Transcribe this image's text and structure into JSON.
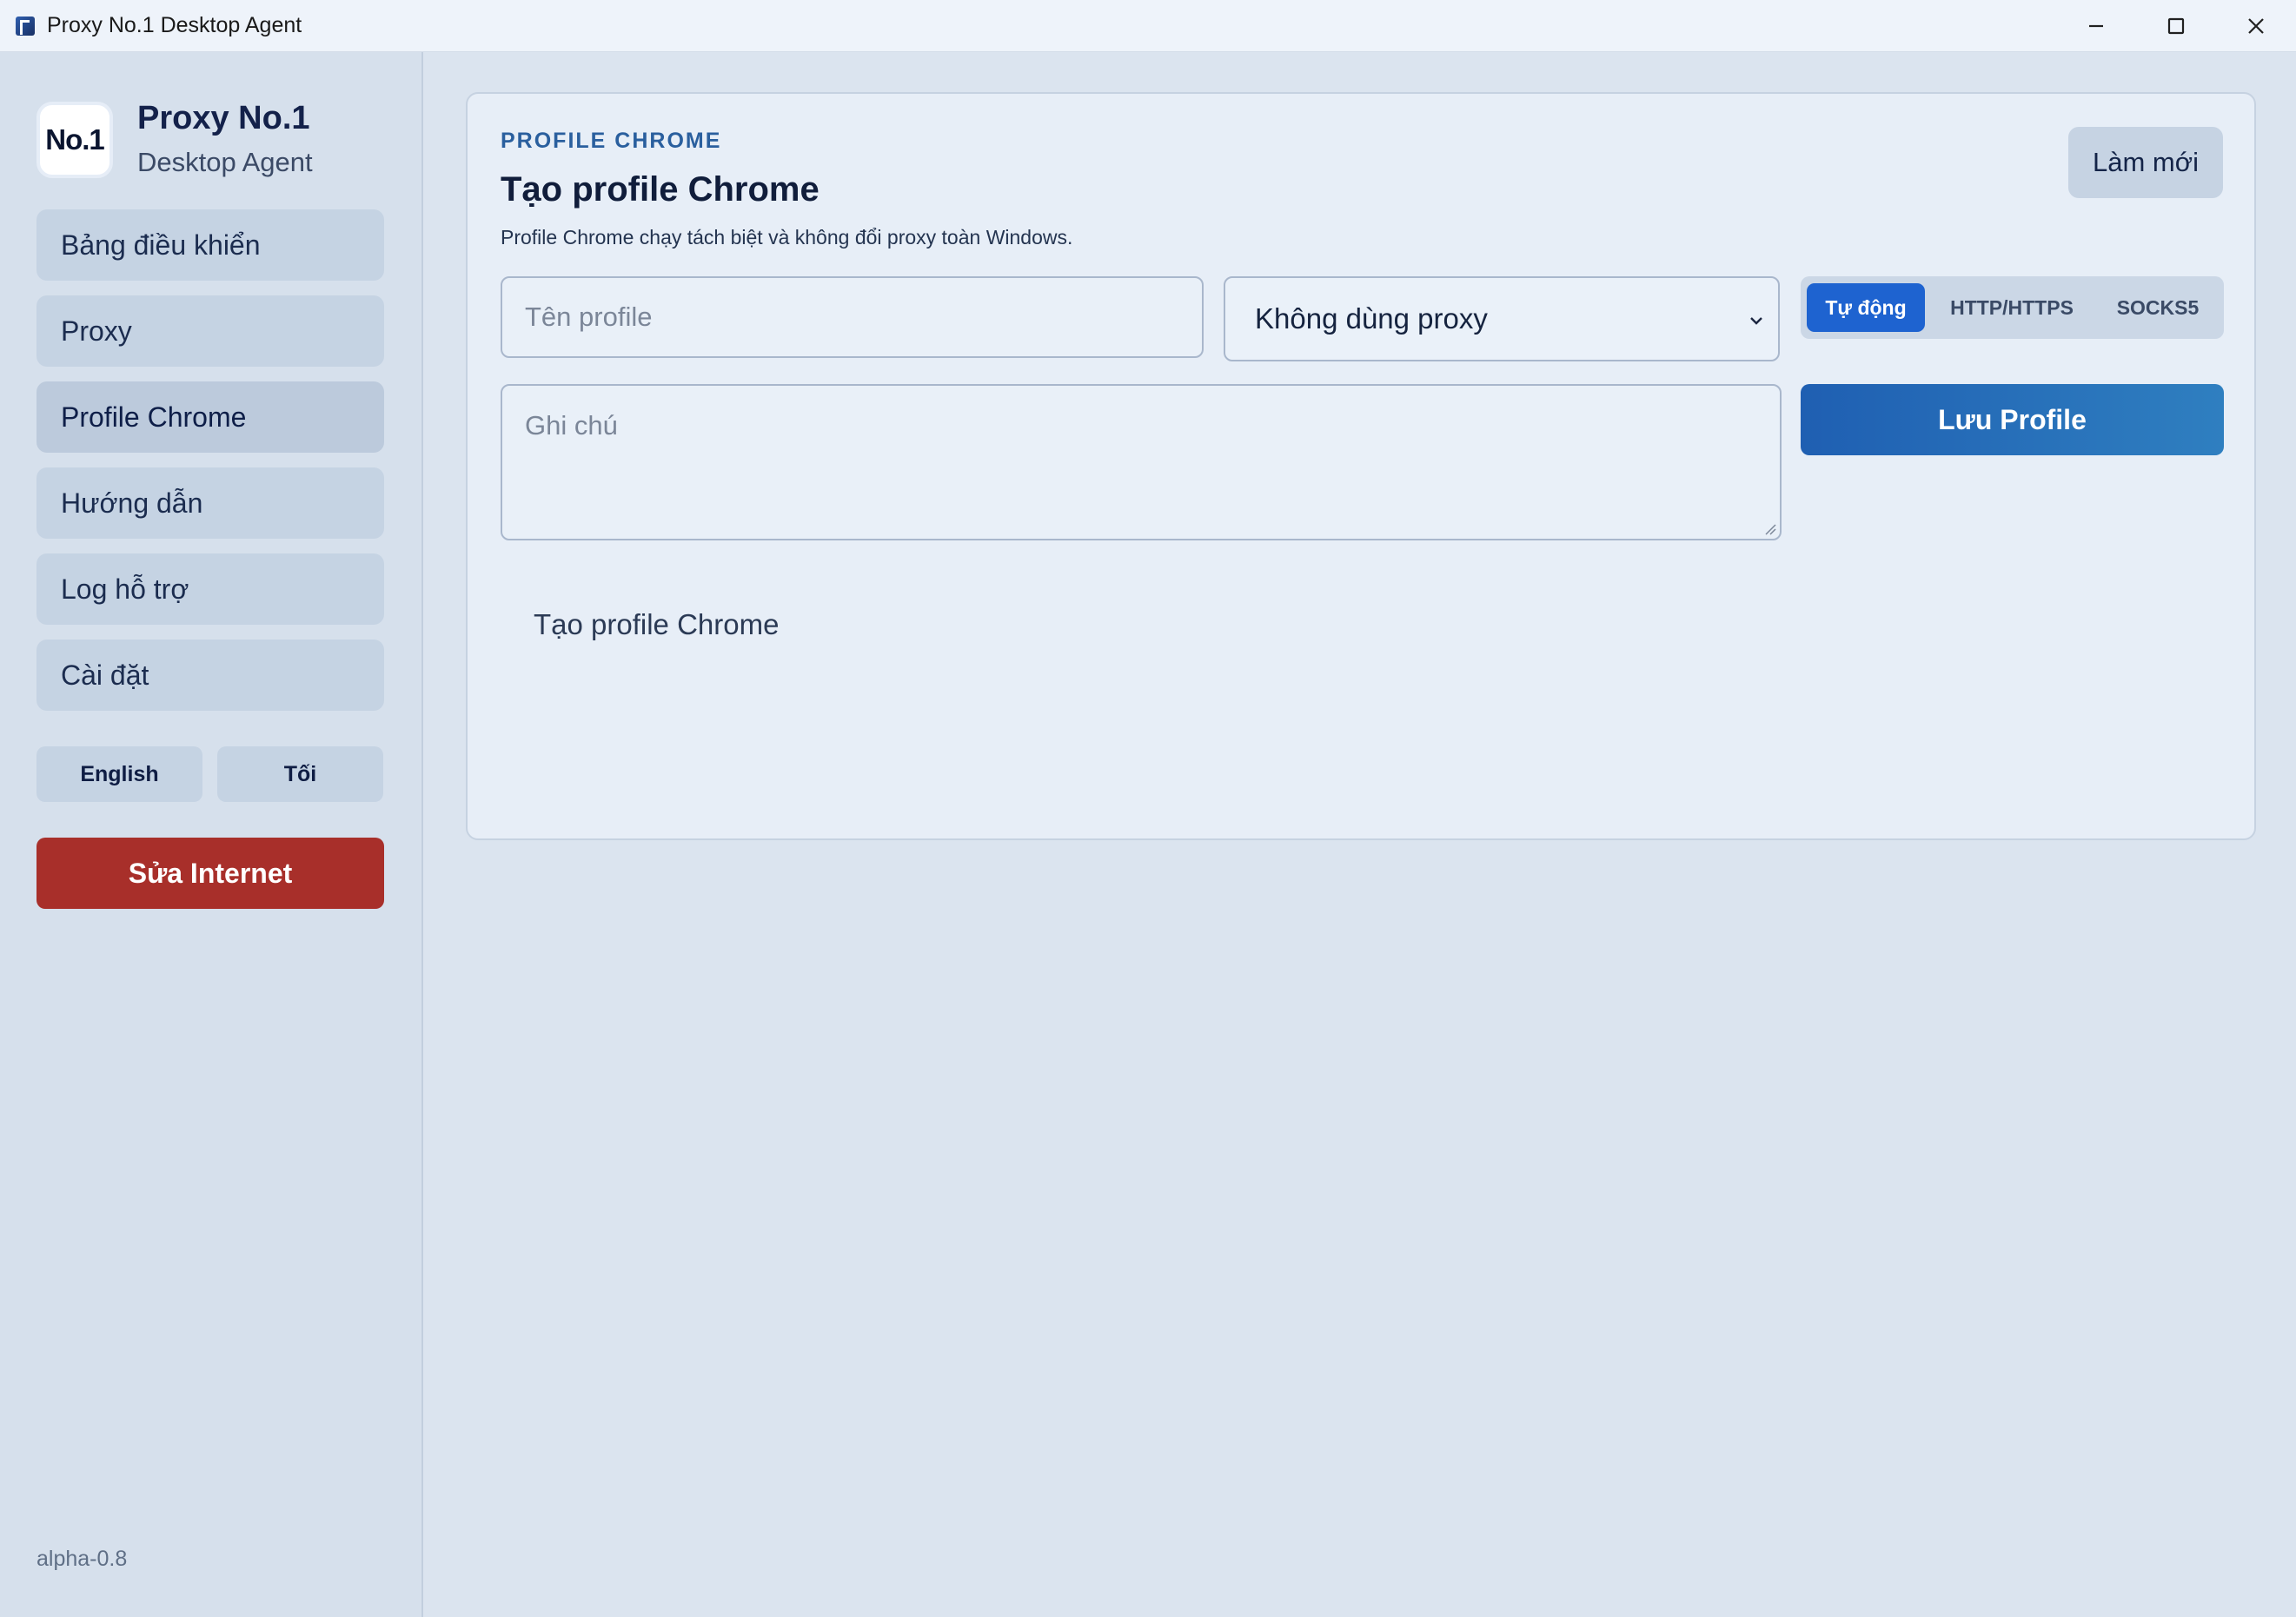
{
  "window": {
    "title": "Proxy No.1 Desktop Agent"
  },
  "brand": {
    "logo_text": "No.1",
    "title": "Proxy No.1",
    "subtitle": "Desktop Agent"
  },
  "sidebar": {
    "items": [
      {
        "label": "Bảng điều khiển",
        "active": false
      },
      {
        "label": "Proxy",
        "active": false
      },
      {
        "label": "Profile Chrome",
        "active": true
      },
      {
        "label": "Hướng dẫn",
        "active": false
      },
      {
        "label": "Log hỗ trợ",
        "active": false
      },
      {
        "label": "Cài đặt",
        "active": false
      }
    ],
    "language_button": "English",
    "theme_button": "Tối",
    "fix_internet_button": "Sửa Internet",
    "version": "alpha-0.8"
  },
  "card": {
    "eyebrow": "PROFILE CHROME",
    "title": "Tạo profile Chrome",
    "description": "Profile Chrome chạy tách biệt và không đổi proxy toàn Windows.",
    "refresh_button": "Làm mới",
    "name_input": {
      "placeholder": "Tên profile",
      "value": ""
    },
    "proxy_select": {
      "selected": "Không dùng proxy"
    },
    "proxy_type_tabs": [
      {
        "label": "Tự động",
        "active": true
      },
      {
        "label": "HTTP/HTTPS",
        "active": false
      },
      {
        "label": "SOCKS5",
        "active": false
      }
    ],
    "notes_input": {
      "placeholder": "Ghi chú",
      "value": ""
    },
    "save_button": "Lưu Profile",
    "empty_state": "Tạo profile Chrome"
  },
  "colors": {
    "accent": "#1e63d0",
    "danger": "#a82f2a",
    "sidebar_bg": "#d6e0ec",
    "card_bg": "#e7eef7"
  }
}
